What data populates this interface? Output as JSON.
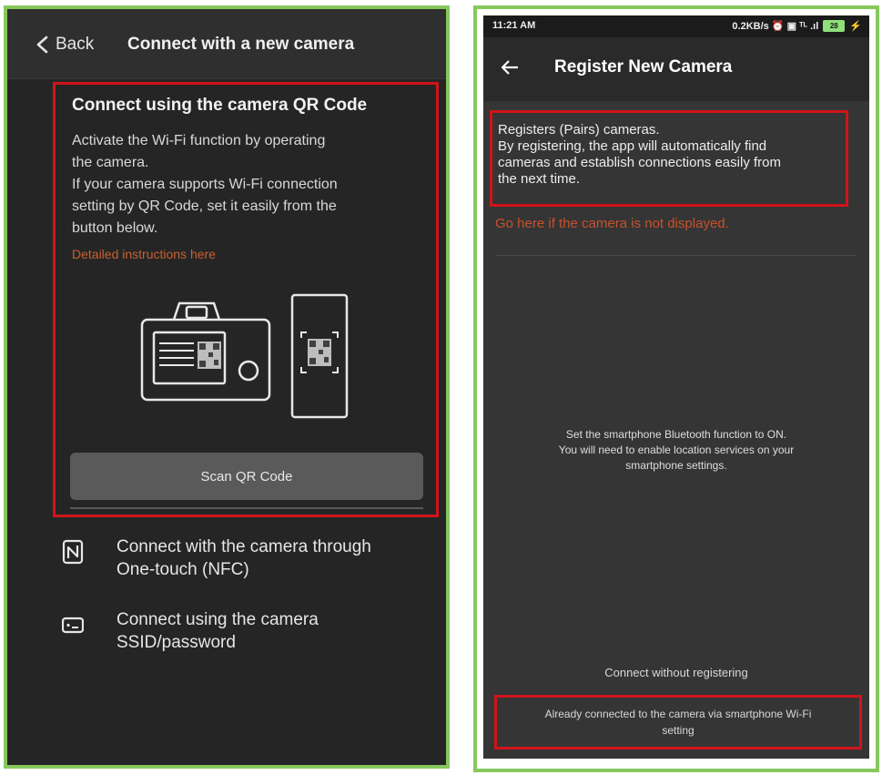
{
  "left": {
    "back_label": "Back",
    "title": "Connect with a new camera",
    "qr_section": {
      "title": "Connect using the camera QR Code",
      "description": "Activate the Wi-Fi function by operating\nthe camera.\nIf your camera supports Wi-Fi connection\nsetting by QR Code, set it easily from the\nbutton below.",
      "instructions_link": "Detailed instructions here",
      "scan_button": "Scan QR Code"
    },
    "options": [
      {
        "icon": "nfc-icon",
        "label": "Connect with the camera through\nOne-touch (NFC)"
      },
      {
        "icon": "ssid-password-icon",
        "label": "Connect using the camera\nSSID/password"
      }
    ]
  },
  "right": {
    "status_bar": {
      "time": "11:21 AM",
      "indicators": "0.2KB/s ⏰ ▣ ᵀᴸ .ıl",
      "battery": "28"
    },
    "title": "Register New Camera",
    "register_text": "Registers (Pairs) cameras.\nBy registering, the app will automatically find\ncameras and establish connections easily from\nthe next time.",
    "not_displayed_link": "Go here if the camera is not displayed.",
    "bluetooth_message": "Set the smartphone Bluetooth function to ON.\nYou will need to enable location services on your\nsmartphone settings.",
    "connect_without_registering": "Connect without registering",
    "already_connected": "Already connected to the camera via smartphone Wi-Fi\nsetting"
  },
  "colors": {
    "frame_green": "#86c85b",
    "highlight_red": "#d0141b",
    "link_orange": "#c9602e",
    "background_dark": "#252525"
  }
}
